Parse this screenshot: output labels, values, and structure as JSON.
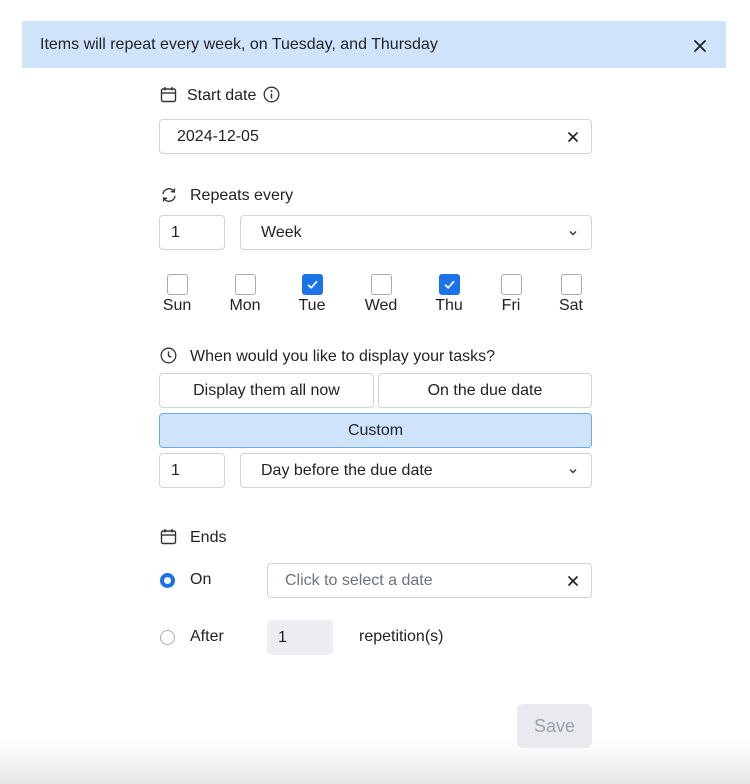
{
  "banner": {
    "text": "Items will repeat every week, on Tuesday, and Thursday"
  },
  "start_date": {
    "label": "Start date",
    "value": "2024-12-05"
  },
  "repeats": {
    "label": "Repeats every",
    "interval": "1",
    "unit": "Week",
    "days": [
      {
        "label": "Sun",
        "checked": false
      },
      {
        "label": "Mon",
        "checked": false
      },
      {
        "label": "Tue",
        "checked": true
      },
      {
        "label": "Wed",
        "checked": false
      },
      {
        "label": "Thu",
        "checked": true
      },
      {
        "label": "Fri",
        "checked": false
      },
      {
        "label": "Sat",
        "checked": false
      }
    ]
  },
  "display": {
    "label": "When would you like to display your tasks?",
    "option_now": "Display them all now",
    "option_due": "On the due date",
    "option_custom": "Custom",
    "selected": "Custom",
    "custom_count": "1",
    "custom_unit": "Day before the due date"
  },
  "ends": {
    "label": "Ends",
    "on_label": "On",
    "on_placeholder": "Click to select a date",
    "after_label": "After",
    "after_count": "1",
    "after_suffix": "repetition(s)",
    "selected": "On"
  },
  "actions": {
    "save_label": "Save"
  },
  "colors": {
    "accent": "#1a73e8",
    "banner_bg": "#cfe4fb",
    "disabled_bg": "#e8eaf0"
  }
}
